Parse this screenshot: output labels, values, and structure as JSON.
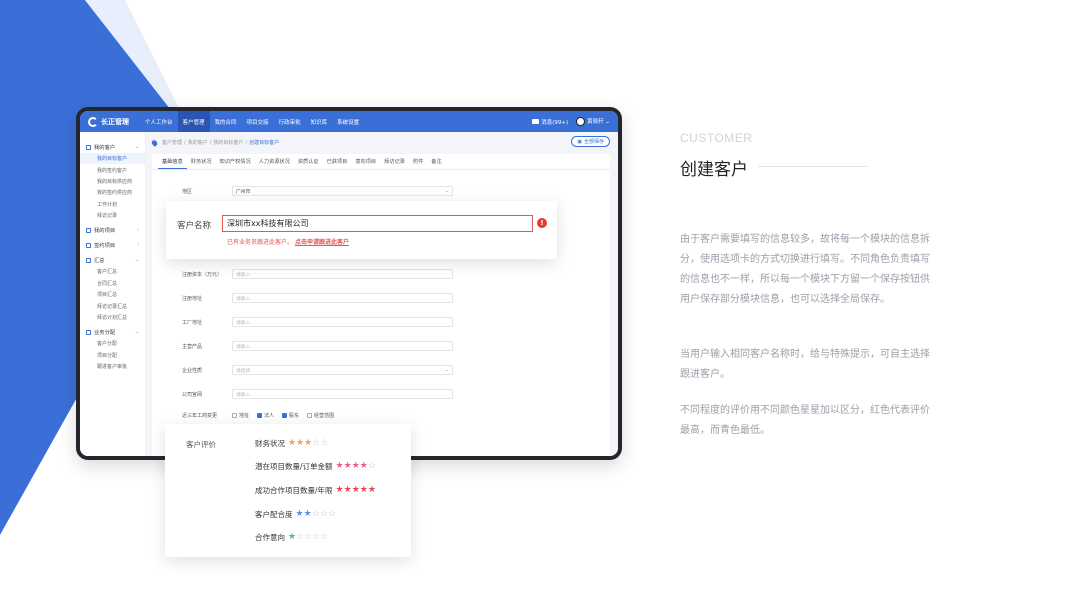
{
  "colors": {
    "brand": "#3b6fd8",
    "error": "#e35757",
    "dark_frame": "#23262d"
  },
  "app": {
    "logo": "长正管理",
    "nav": [
      "个人工作台",
      "客户管理",
      "我的合同",
      "项目交接",
      "行政审批",
      "知识库",
      "系统设置"
    ],
    "active_nav": 1,
    "messages": "消息(99+)",
    "user": "黄晓轩"
  },
  "sidebar": [
    {
      "icon": "user-icon",
      "label": "我的客户",
      "children": [
        "我的目标客户",
        "我的签约客户",
        "我的目标供应商",
        "我的签约供应商",
        "工作计划",
        "拜访记录"
      ],
      "active_child": 0
    },
    {
      "icon": "project-icon",
      "label": "我的项目",
      "children": []
    },
    {
      "icon": "contract-icon",
      "label": "签约项目",
      "children": []
    },
    {
      "icon": "summary-icon",
      "label": "汇总",
      "children": [
        "客户汇总",
        "合同汇总",
        "项目汇总",
        "拜访记录汇总",
        "拜访计划汇总"
      ]
    },
    {
      "icon": "assign-icon",
      "label": "业务分配",
      "children": [
        "客户分配",
        "项目分配",
        "跟进客户审批"
      ]
    }
  ],
  "breadcrumb": [
    "客户管理",
    "我的客户",
    "我的目标客户",
    "创建目标客户"
  ],
  "save_all": "全部保存",
  "tabs": [
    "基础信息",
    "财务状况",
    "知识产权情况",
    "人力资源状况",
    "资质认证",
    "已获项目",
    "意向项目",
    "拜访记录",
    "附件",
    "备注"
  ],
  "active_tab": 0,
  "form": {
    "region": {
      "label": "地区",
      "value": "广州市"
    },
    "capital": {
      "label": "注册资本（万元）",
      "placeholder": "请输入"
    },
    "address": {
      "label": "注册地址",
      "placeholder": "请输入"
    },
    "factory": {
      "label": "工厂地址",
      "placeholder": "请输入"
    },
    "product": {
      "label": "主营产品",
      "placeholder": "请输入"
    },
    "nature": {
      "label": "企业性质",
      "placeholder": "请选择"
    },
    "website": {
      "label": "公司官网",
      "placeholder": "请输入"
    },
    "changes": {
      "label": "近三年工商变更",
      "options": [
        {
          "label": "地址",
          "checked": false
        },
        {
          "label": "法人",
          "checked": true
        },
        {
          "label": "股东",
          "checked": true
        },
        {
          "label": "经营范围",
          "checked": false
        }
      ]
    }
  },
  "name_card": {
    "label": "客户名称",
    "value": "深圳市xx科技有限公司",
    "error": "已有业务员跟进此客户。",
    "error_link": "点击申请跟进此客户"
  },
  "rating_card": {
    "label": "客户评价",
    "rows": [
      {
        "label": "财务状况",
        "stars": 3,
        "color": "#f0a45d"
      },
      {
        "label": "潜在项目数量/订单金额",
        "stars": 4,
        "color": "#e0648c"
      },
      {
        "label": "成功合作项目数量/年限",
        "stars": 5,
        "color": "#e14b5a"
      },
      {
        "label": "客户配合度",
        "stars": 2,
        "color": "#5b8fe0"
      },
      {
        "label": "合作意向",
        "stars": 1,
        "color": "#3dbdb0"
      }
    ]
  },
  "side": {
    "eyebrow": "CUSTOMER",
    "title": "创建客户",
    "paragraphs": [
      "由于客户需要填写的信息较多，故将每一个模块的信息拆分，使用选项卡的方式切换进行填写。不同角色负责填写的信息也不一样，所以每一个模块下方留一个保存按钮供用户保存部分模块信息，也可以选择全局保存。",
      "当用户输入相同客户名称时，给与特殊提示，可自主选择跟进客户。",
      "不同程度的评价用不同颜色星星加以区分，红色代表评价最高，而青色最低。"
    ]
  }
}
